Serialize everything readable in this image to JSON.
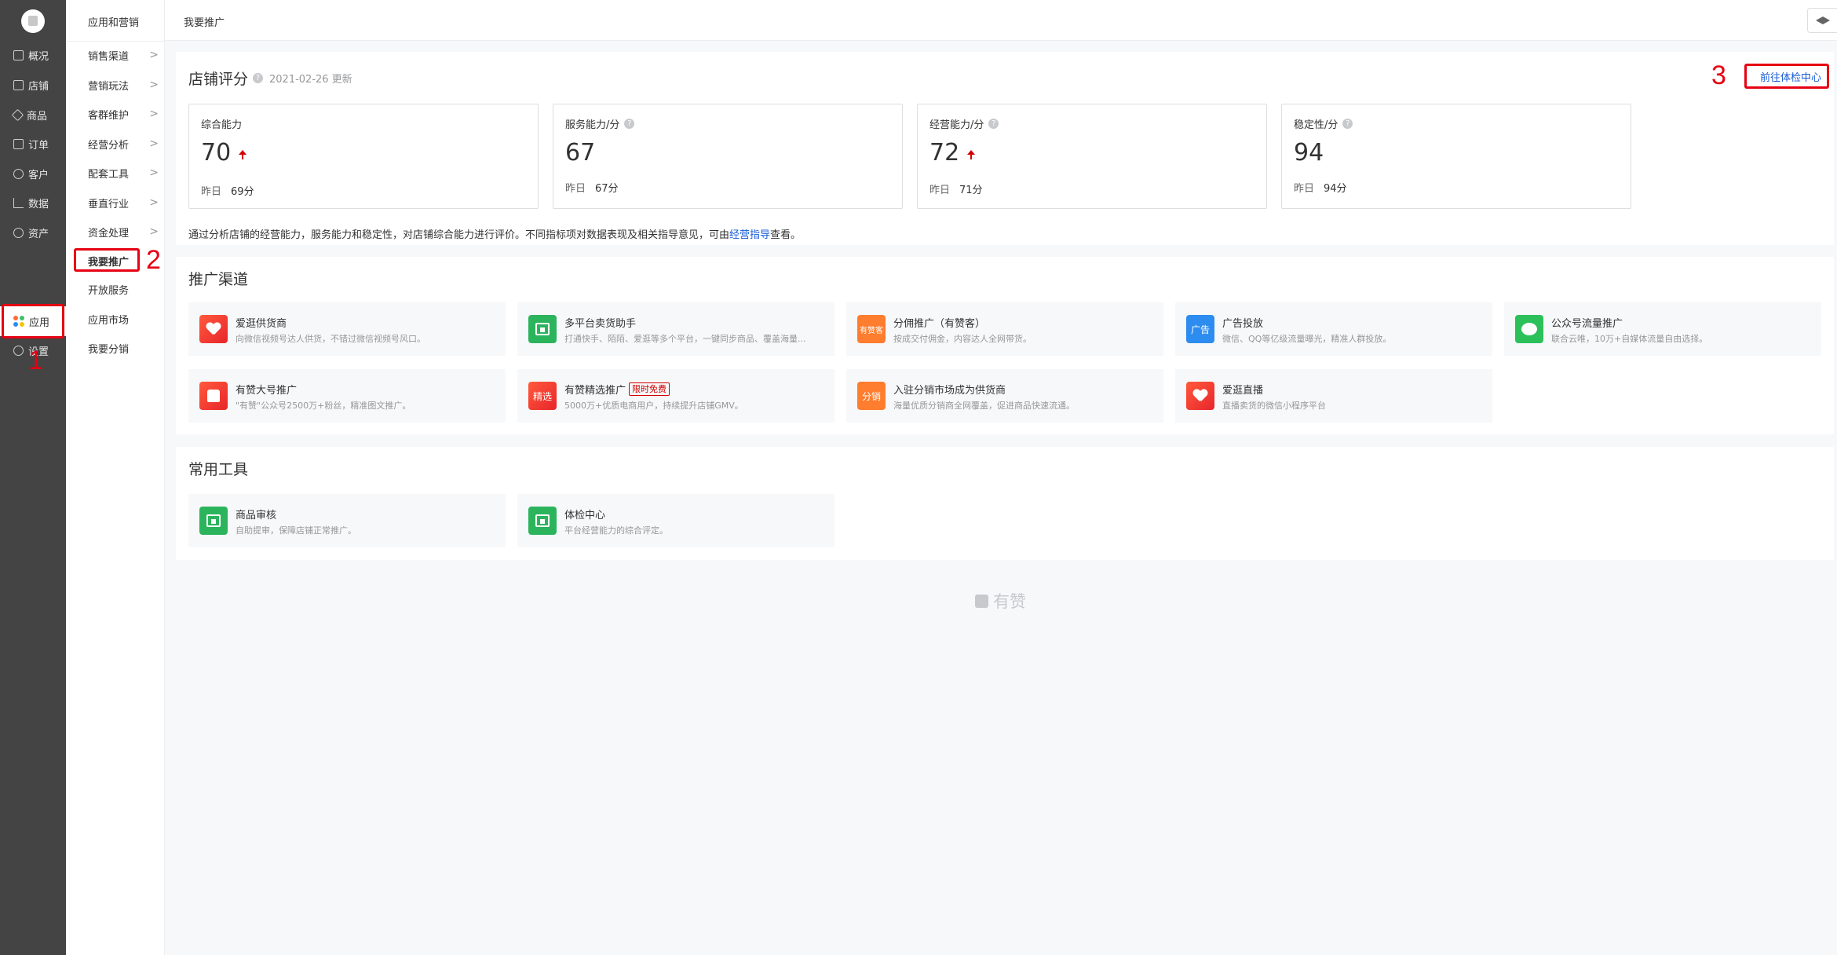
{
  "sidebar": {
    "items": [
      {
        "label": "概况",
        "icon": "monitor-icon"
      },
      {
        "label": "店铺",
        "icon": "store-icon"
      },
      {
        "label": "商品",
        "icon": "tag-icon"
      },
      {
        "label": "订单",
        "icon": "order-icon"
      },
      {
        "label": "客户",
        "icon": "user-icon"
      },
      {
        "label": "数据",
        "icon": "chart-icon"
      },
      {
        "label": "资产",
        "icon": "coin-icon"
      },
      {
        "label": "应用",
        "icon": "apps-icon"
      },
      {
        "label": "设置",
        "icon": "gear-icon"
      }
    ]
  },
  "submenu": {
    "title": "应用和营销",
    "items": [
      {
        "label": "销售渠道",
        "chevron": ">"
      },
      {
        "label": "营销玩法",
        "chevron": ">"
      },
      {
        "label": "客群维护",
        "chevron": ">"
      },
      {
        "label": "经营分析",
        "chevron": ">"
      },
      {
        "label": "配套工具",
        "chevron": ">"
      },
      {
        "label": "垂直行业",
        "chevron": ">"
      },
      {
        "label": "资金处理",
        "chevron": ">"
      },
      {
        "label": "我要推广"
      },
      {
        "label": "开放服务"
      },
      {
        "label": "应用市场"
      },
      {
        "label": "我要分销"
      }
    ]
  },
  "header": {
    "title": "我要推广"
  },
  "score": {
    "title": "店铺评分",
    "updated": "2021-02-26 更新",
    "link": "前往体检中心",
    "cards": [
      {
        "label": "综合能力",
        "value": "70",
        "yesterday_label": "昨日",
        "yesterday": "69分",
        "trend": "up"
      },
      {
        "label": "服务能力/分",
        "value": "67",
        "yesterday_label": "昨日",
        "yesterday": "67分",
        "trend": "none"
      },
      {
        "label": "经营能力/分",
        "value": "72",
        "yesterday_label": "昨日",
        "yesterday": "71分",
        "trend": "up"
      },
      {
        "label": "稳定性/分",
        "value": "94",
        "yesterday_label": "昨日",
        "yesterday": "94分",
        "trend": "none"
      }
    ],
    "desc_prefix": "通过分析店铺的经营能力，服务能力和稳定性，对店铺综合能力进行评价。不同指标项对数据表现及相关指导意见，可由",
    "desc_link": "经营指导",
    "desc_suffix": "查看。"
  },
  "channels": {
    "title": "推广渠道",
    "items": [
      {
        "name": "爱逛供货商",
        "desc": "向微信视频号达人供货，不错过微信视频号风口。",
        "icon": "heart-icon"
      },
      {
        "name": "多平台卖货助手",
        "desc": "打通快手、陌陌、爱逛等多个平台，一键同步商品、覆盖海量...",
        "icon": "store-icon"
      },
      {
        "name": "分佣推广（有赞客）",
        "desc": "按成交付佣金，内容达人全网带货。",
        "icon": "youzanke-icon",
        "icon_text": "有赞客"
      },
      {
        "name": "广告投放",
        "desc": "微信、QQ等亿级流量曝光，精准人群投放。",
        "icon": "ad-icon",
        "icon_text": "广告"
      },
      {
        "name": "公众号流量推广",
        "desc": "联合云唯，10万+自媒体流量自由选择。",
        "icon": "wechat-icon"
      },
      {
        "name": "有赞大号推广",
        "desc": "\"有赞\"公众号2500万+粉丝，精准图文推广。",
        "icon": "thumb-up-icon"
      },
      {
        "name": "有赞精选推广",
        "tag": "限时免费",
        "desc": "5000万+优质电商用户，持续提升店铺GMV。",
        "icon": "jingxuan-icon",
        "icon_text": "精选"
      },
      {
        "name": "入驻分销市场成为供货商",
        "desc": "海量优质分销商全网覆盖，促进商品快速流通。",
        "icon": "fenxiao-icon",
        "icon_text": "分销"
      },
      {
        "name": "爱逛直播",
        "desc": "直播卖货的微信小程序平台",
        "icon": "heart-icon"
      }
    ]
  },
  "tools": {
    "title": "常用工具",
    "items": [
      {
        "name": "商品审核",
        "desc": "自助提审，保障店铺正常推广。",
        "icon": "store-icon"
      },
      {
        "name": "体检中心",
        "desc": "平台经营能力的综合评定。",
        "icon": "store-icon"
      }
    ]
  },
  "annotations": [
    "1",
    "2",
    "3"
  ],
  "footer": {
    "brand": "有赞"
  },
  "colors": {
    "accent_red": "#e60012",
    "link_blue": "#155bd4",
    "sidebar_bg": "#444444"
  }
}
